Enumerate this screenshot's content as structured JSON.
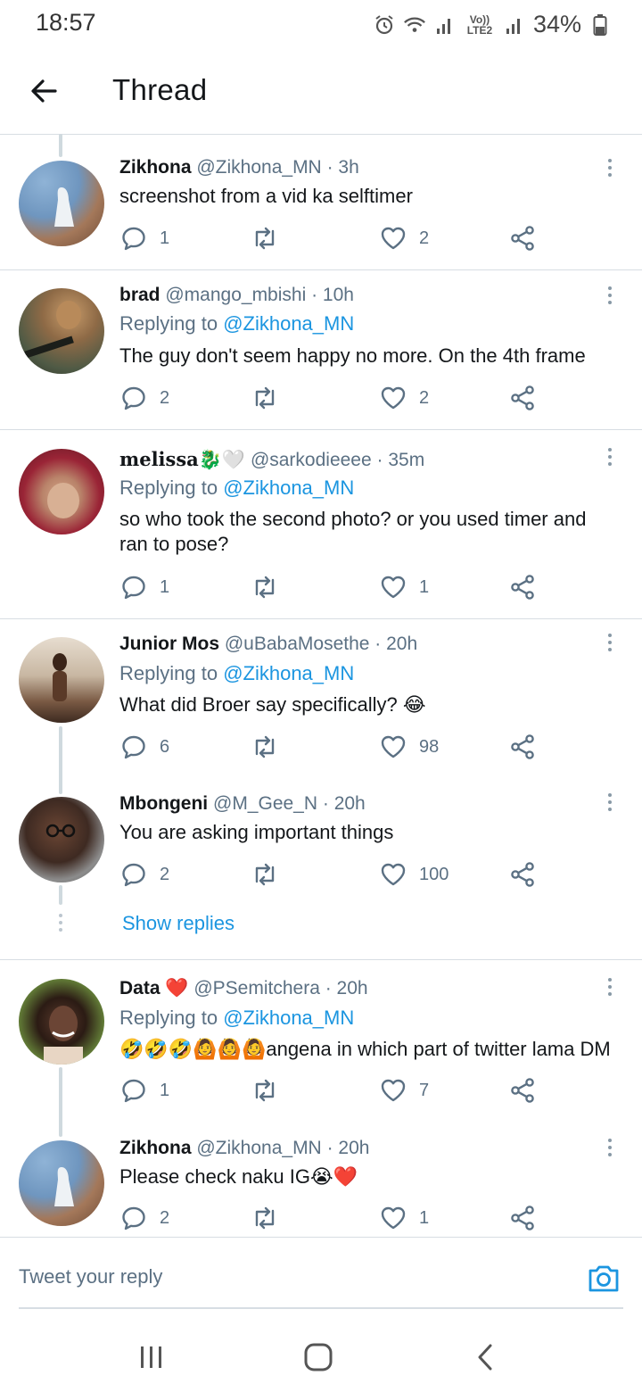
{
  "status_bar": {
    "time": "18:57",
    "network_label": "Vo)) LTE2",
    "battery": "34%"
  },
  "header": {
    "title": "Thread",
    "back_icon": "arrow-left-icon"
  },
  "colors": {
    "link_blue": "#1b95e0",
    "secondary_text": "#5b7083",
    "divider": "#d7dde3"
  },
  "tweets": [
    {
      "name": "Zikhona",
      "handle": "@Zikhona_MN",
      "time": "· 3h",
      "reply_prefix": "",
      "reply_mention": "",
      "text": "screenshot from a vid ka selftimer",
      "replies": "1",
      "retweets": "",
      "likes": "2"
    },
    {
      "name": "brad",
      "handle": "@mango_mbishi",
      "time": "· 10h",
      "reply_prefix": "Replying to ",
      "reply_mention": "@Zikhona_MN",
      "text": "The guy don't seem happy no more. On the 4th frame",
      "replies": "2",
      "retweets": "",
      "likes": "2"
    },
    {
      "name": "melissa🐉🤍",
      "handle": "@sarkodieeee",
      "time": "· 35m",
      "reply_prefix": "Replying to ",
      "reply_mention": "@Zikhona_MN",
      "text": "so who took the second photo? or you used timer and ran to pose?",
      "replies": "1",
      "retweets": "",
      "likes": "1"
    },
    {
      "name": "Junior Mos",
      "handle": "@uBabaMosethe",
      "time": "· 20h",
      "reply_prefix": "Replying to ",
      "reply_mention": "@Zikhona_MN",
      "text": "What did Broer say specifically? 😂",
      "replies": "6",
      "retweets": "",
      "likes": "98"
    },
    {
      "name": "Mbongeni",
      "handle": "@M_Gee_N",
      "time": "· 20h",
      "reply_prefix": "",
      "reply_mention": "",
      "text": "You are asking important things",
      "replies": "2",
      "retweets": "",
      "likes": "100"
    },
    {
      "name": "Data ❤️",
      "handle": "@PSemitchera",
      "time": "· 20h",
      "reply_prefix": "Replying to ",
      "reply_mention": "@Zikhona_MN",
      "text": "🤣🤣🤣🙆🙆🙆angena in which part of twitter lama DM",
      "replies": "1",
      "retweets": "",
      "likes": "7"
    },
    {
      "name": "Zikhona",
      "handle": "@Zikhona_MN",
      "time": "· 20h",
      "reply_prefix": "",
      "reply_mention": "",
      "text": "Please check naku IG😭❤️",
      "replies": "2",
      "retweets": "",
      "likes": "1"
    }
  ],
  "show_replies_label": "Show replies",
  "reply_bar": {
    "placeholder": "Tweet your reply",
    "camera_icon": "camera-icon"
  },
  "nav_bar": {
    "icons": [
      "recent-apps-icon",
      "home-icon",
      "back-icon"
    ]
  }
}
